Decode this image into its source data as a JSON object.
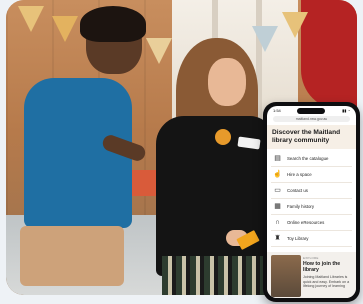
{
  "phone": {
    "status": {
      "time": "1:54"
    },
    "url": "maitland.nsw.gov.au",
    "hero_title": "Discover the Maitland library community",
    "menu": [
      {
        "label": "Search the catalogue",
        "icon": "book-icon"
      },
      {
        "label": "Hire a space",
        "icon": "hand-pointer-icon"
      },
      {
        "label": "Contact us",
        "icon": "chat-bubble-icon"
      },
      {
        "label": "Family history",
        "icon": "document-icon"
      },
      {
        "label": "Online eResources",
        "icon": "headphones-icon"
      },
      {
        "label": "Toy Library",
        "icon": "toy-icon"
      }
    ],
    "feature": {
      "tag": "EXPLORE",
      "title": "How to join the library",
      "body": "Joining Maitland Libraries is quick and easy. Embark on a lifelong journey of learning"
    }
  },
  "colors": {
    "accent_red": "#b52323",
    "hero_bg": "#f6efe6",
    "shirt_blue": "#1f6fa3"
  }
}
